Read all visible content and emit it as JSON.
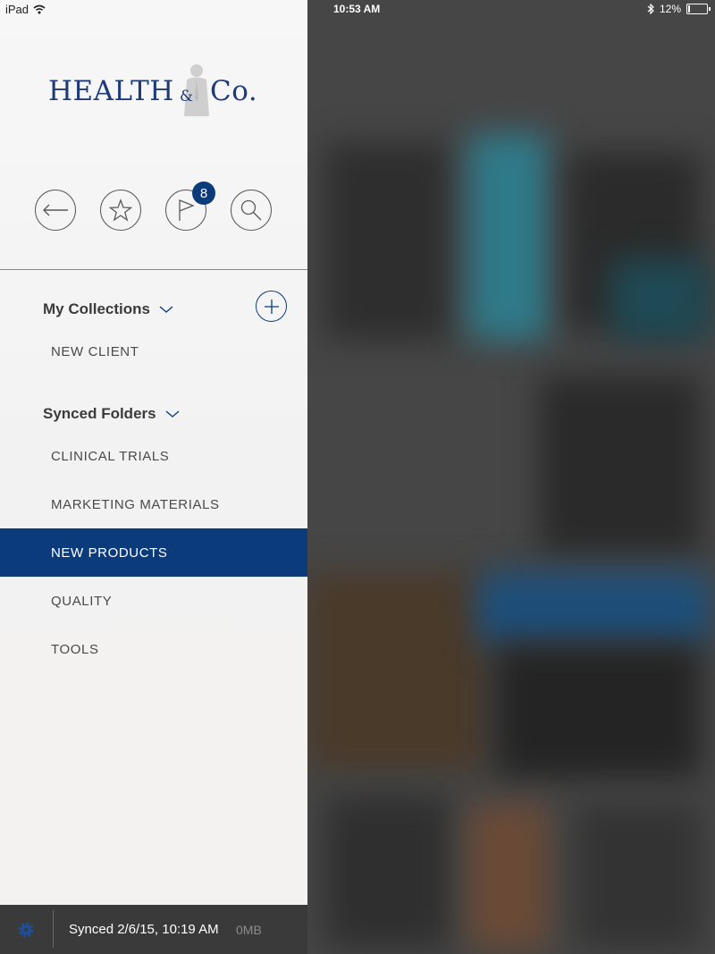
{
  "status_bar": {
    "device": "iPad",
    "time": "10:53 AM",
    "battery": "12%",
    "battery_level": 0.12
  },
  "brand": {
    "left": "HEALTH",
    "amp": "&",
    "right": "Co."
  },
  "toolbar": {
    "back_icon": "arrow-left-icon",
    "favorites_icon": "star-icon",
    "flag_icon": "flag-icon",
    "flag_badge": "8",
    "search_icon": "search-icon"
  },
  "collections": {
    "title": "My Collections",
    "items": [
      "NEW CLIENT"
    ]
  },
  "synced_folders": {
    "title": "Synced Folders",
    "items": [
      "CLINICAL TRIALS",
      "MARKETING MATERIALS",
      "NEW PRODUCTS",
      "QUALITY",
      "TOOLS"
    ],
    "selected": "NEW PRODUCTS"
  },
  "footer": {
    "status": "Synced 2/6/15, 10:19 AM",
    "size": "0MB"
  },
  "colors": {
    "accent": "#0c3b7c",
    "brand": "#1f3a7a",
    "footer": "#3a3a3a"
  }
}
